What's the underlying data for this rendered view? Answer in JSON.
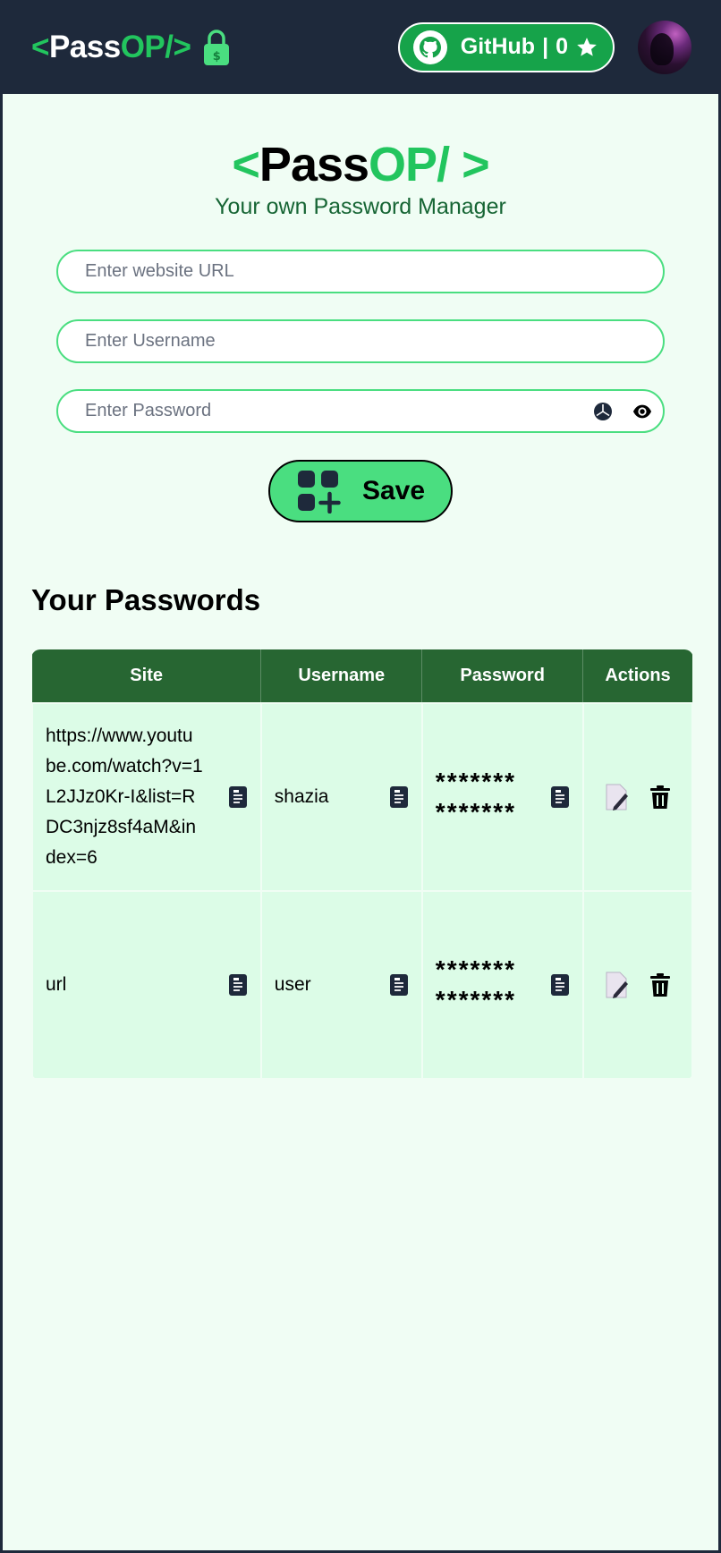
{
  "navbar": {
    "logo": {
      "open": "<",
      "pass": "Pass",
      "op": "OP/",
      "close": " >"
    },
    "github": {
      "label": "GitHub",
      "separator": "|",
      "count": "0"
    }
  },
  "hero": {
    "title": {
      "open": "<",
      "pass": "Pass",
      "op": "OP/",
      "close": " >"
    },
    "subtitle": "Your own Password Manager"
  },
  "form": {
    "url_placeholder": "Enter website URL",
    "username_placeholder": "Enter Username",
    "password_placeholder": "Enter Password",
    "save_label": "Save"
  },
  "passwords": {
    "title": "Your Passwords",
    "columns": [
      "Site",
      "Username",
      "Password",
      "Actions"
    ],
    "rows": [
      {
        "site": "https://www.youtube.com/watch?v=1L2JJz0Kr-I&list=RDC3njz8sf4aM&index=6",
        "username": "shazia",
        "password": "**************"
      },
      {
        "site": "url",
        "username": "user",
        "password": "**************"
      }
    ]
  },
  "colors": {
    "nav_bg": "#1e293b",
    "accent": "#22c55e",
    "header_bg": "#276632",
    "row_bg": "#dcfce7",
    "page_bg": "#f0fdf4"
  },
  "icons": [
    "lock-icon",
    "github-icon",
    "star-icon",
    "eye-icon",
    "generate-icon",
    "add-icon",
    "copy-icon",
    "edit-icon",
    "delete-icon"
  ]
}
